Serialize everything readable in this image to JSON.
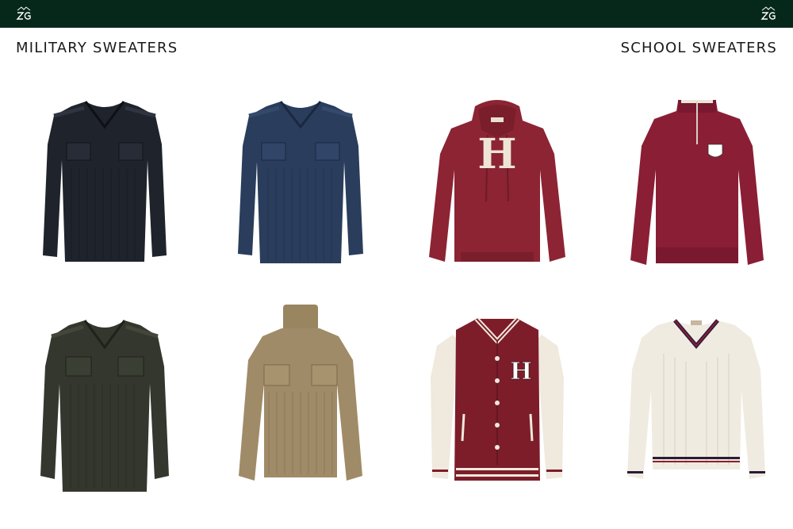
{
  "header": {
    "logo_left": "zg-monogram-icon",
    "logo_right": "zg-monogram-icon",
    "bar_color": "#06281a"
  },
  "sections": {
    "military_title": "MILITARY SWEATERS",
    "school_title": "SCHOOL SWEATERS"
  },
  "products": [
    {
      "name": "black-commando-sweater",
      "color": "#1f232b"
    },
    {
      "name": "navy-commando-sweater",
      "color": "#2a3d5c"
    },
    {
      "name": "maroon-h-hoodie",
      "color": "#8c2433"
    },
    {
      "name": "maroon-quarter-zip-sweater",
      "color": "#8a1e35"
    },
    {
      "name": "olive-commando-sweater",
      "color": "#33372d"
    },
    {
      "name": "khaki-turtleneck-sweater",
      "color": "#a08b68"
    },
    {
      "name": "maroon-varsity-jacket",
      "color": "#7d1d2a"
    },
    {
      "name": "cream-cricket-sweater",
      "color": "#f0ebe0"
    }
  ],
  "letters": {
    "hoodie": "H",
    "jacket": "H"
  }
}
